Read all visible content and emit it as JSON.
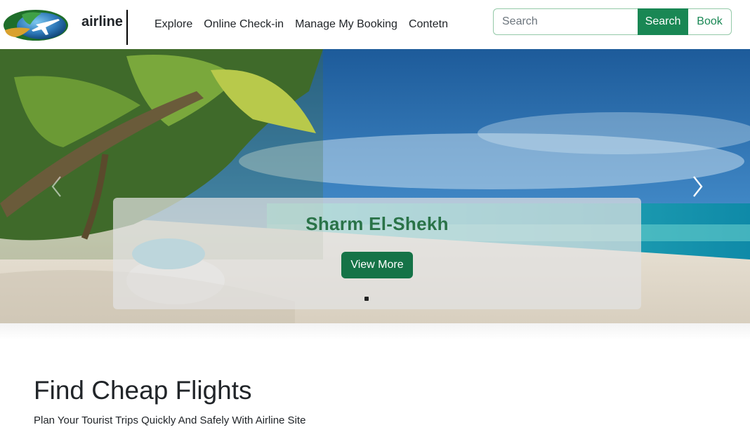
{
  "navbar": {
    "brand": "airline",
    "links": [
      "Explore",
      "Online Check-in",
      "Manage My Booking",
      "Contetn"
    ],
    "search_placeholder": "Search",
    "search_value": "",
    "search_button": "Search",
    "book_button": "Book"
  },
  "hero": {
    "caption_title": "Sharm El-Shekh",
    "view_more": "View More",
    "slide_count": 1,
    "active_slide": 1
  },
  "section": {
    "title": "Find Cheap Flights",
    "subtitle": "Plan Your Tourist Trips Quickly And Safely With Airline Site"
  },
  "colors": {
    "accent": "#198754",
    "caption_title": "#2a7348"
  },
  "icons": {
    "logo": "airline-logo-globe-plane",
    "prev": "chevron-left-icon",
    "next": "chevron-right-icon"
  }
}
